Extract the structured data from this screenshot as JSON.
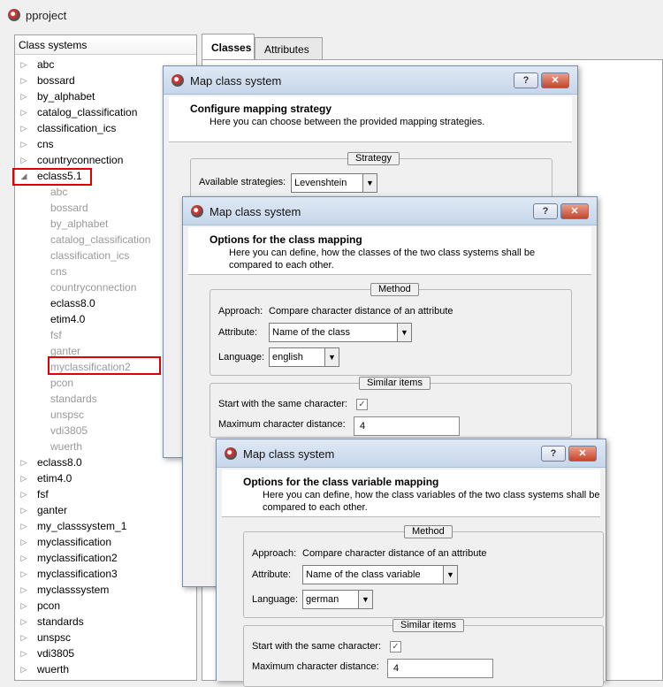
{
  "app": {
    "title": "pproject"
  },
  "tree": {
    "header": "Class systems",
    "items": [
      {
        "label": "abc",
        "arrow": "▷"
      },
      {
        "label": "bossard",
        "arrow": "▷"
      },
      {
        "label": "by_alphabet",
        "arrow": "▷"
      },
      {
        "label": "catalog_classification",
        "arrow": "▷"
      },
      {
        "label": "classification_ics",
        "arrow": "▷"
      },
      {
        "label": "cns",
        "arrow": "▷"
      },
      {
        "label": "countryconnection",
        "arrow": "▷"
      },
      {
        "label": "eclass5.1",
        "arrow": "◢"
      },
      {
        "label": "abc",
        "arrow": ""
      },
      {
        "label": "bossard",
        "arrow": ""
      },
      {
        "label": "by_alphabet",
        "arrow": ""
      },
      {
        "label": "catalog_classification",
        "arrow": ""
      },
      {
        "label": "classification_ics",
        "arrow": ""
      },
      {
        "label": "cns",
        "arrow": ""
      },
      {
        "label": "countryconnection",
        "arrow": ""
      },
      {
        "label": "eclass8.0",
        "arrow": ""
      },
      {
        "label": "etim4.0",
        "arrow": ""
      },
      {
        "label": "fsf",
        "arrow": ""
      },
      {
        "label": "ganter",
        "arrow": ""
      },
      {
        "label": "myclassification2",
        "arrow": ""
      },
      {
        "label": "pcon",
        "arrow": ""
      },
      {
        "label": "standards",
        "arrow": ""
      },
      {
        "label": "unspsc",
        "arrow": ""
      },
      {
        "label": "vdi3805",
        "arrow": ""
      },
      {
        "label": "wuerth",
        "arrow": ""
      },
      {
        "label": "eclass8.0",
        "arrow": "▷"
      },
      {
        "label": "etim4.0",
        "arrow": "▷"
      },
      {
        "label": "fsf",
        "arrow": "▷"
      },
      {
        "label": "ganter",
        "arrow": "▷"
      },
      {
        "label": "my_classsystem_1",
        "arrow": "▷"
      },
      {
        "label": "myclassification",
        "arrow": "▷"
      },
      {
        "label": "myclassification2",
        "arrow": "▷"
      },
      {
        "label": "myclassification3",
        "arrow": "▷"
      },
      {
        "label": "myclasssystem",
        "arrow": "▷"
      },
      {
        "label": "pcon",
        "arrow": "▷"
      },
      {
        "label": "standards",
        "arrow": "▷"
      },
      {
        "label": "unspsc",
        "arrow": "▷"
      },
      {
        "label": "vdi3805",
        "arrow": "▷"
      },
      {
        "label": "wuerth",
        "arrow": "▷"
      }
    ]
  },
  "tabs": [
    {
      "label": "Classes"
    },
    {
      "label": "Attributes"
    }
  ],
  "dialog1": {
    "title": "Map class system",
    "help_label": "?",
    "close_label": "✕",
    "header_title": "Configure mapping strategy",
    "header_sub": "Here you can choose between the provided mapping strategies.",
    "group_title": "Strategy",
    "strategies_label": "Available strategies:",
    "strategy_value": "Levenshtein"
  },
  "dialog2": {
    "title": "Map class system",
    "help_label": "?",
    "close_label": "✕",
    "header_title": "Options for the class mapping",
    "header_sub": "Here you can define, how the classes of the two class systems shall be compared to each other.",
    "method_title": "Method",
    "approach_label": "Approach:",
    "approach_value": "Compare character distance of an attribute",
    "attribute_label": "Attribute:",
    "attribute_value": "Name of the class",
    "language_label": "Language:",
    "language_value": "english",
    "similar_title": "Similar items",
    "start_same_label": "Start with the same character:",
    "start_same_checked": "✓",
    "max_dist_label": "Maximum character distance:",
    "max_dist_value": "4"
  },
  "dialog3": {
    "title": "Map class system",
    "help_label": "?",
    "close_label": "✕",
    "header_title": "Options for the class variable mapping",
    "header_sub": "Here you can define, how the class variables of the two class systems shall be compared to each other.",
    "method_title": "Method",
    "approach_label": "Approach:",
    "approach_value": "Compare character distance of an attribute",
    "attribute_label": "Attribute:",
    "attribute_value": "Name of the class variable",
    "language_label": "Language:",
    "language_value": "german",
    "similar_title": "Similar items",
    "start_same_label": "Start with the same character:",
    "start_same_checked": "✓",
    "max_dist_label": "Maximum character distance:",
    "max_dist_value": "4"
  },
  "colors": {
    "highlight": "#e00000",
    "accent": "#7a8ea8"
  }
}
